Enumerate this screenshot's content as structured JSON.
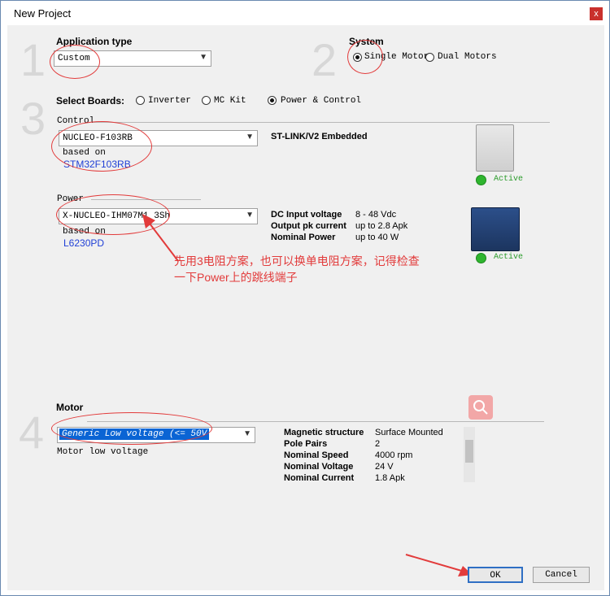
{
  "window": {
    "title": "New Project",
    "close_glyph": "x"
  },
  "steps": {
    "s1": "1",
    "s2": "2",
    "s3": "3",
    "s4": "4"
  },
  "application_type": {
    "label": "Application type",
    "value": "Custom",
    "arrow": "▼"
  },
  "system": {
    "label": "System",
    "options": [
      "Single Motor",
      "Dual Motors"
    ],
    "selected": "Single Motor"
  },
  "select_boards": {
    "label": "Select Boards:",
    "options": [
      "Inverter",
      "MC Kit",
      "Power & Control"
    ],
    "selected": "Power & Control"
  },
  "control": {
    "label": "Control",
    "value": "NUCLEO-F103RB",
    "arrow": "▼",
    "based_on_label": "based on",
    "based_on_value": "STM32F103RB",
    "spec_title": "ST-LINK/V2 Embedded",
    "status": "Active"
  },
  "power": {
    "label": "Power",
    "value": "X-NUCLEO-IHM07M1 3Sh",
    "arrow": "▼",
    "based_on_label": "based on",
    "based_on_value": "L6230PD",
    "specs": [
      {
        "name": "DC Input voltage",
        "value": "8 - 48 Vdc"
      },
      {
        "name": "Output pk current",
        "value": "up to 2.8 Apk"
      },
      {
        "name": "Nominal Power",
        "value": "up to 40 W"
      }
    ],
    "status": "Active"
  },
  "annotation": {
    "line1": "先用3电阻方案，也可以换单电阻方案，记得检查",
    "line2": "一下Power上的跳线端子"
  },
  "motor": {
    "label": "Motor",
    "value": "Generic Low voltage (<= 50V",
    "arrow": "▼",
    "description": "Motor low voltage",
    "specs": [
      {
        "name": "Magnetic structure",
        "value": "Surface Mounted"
      },
      {
        "name": "Pole Pairs",
        "value": "2"
      },
      {
        "name": "Nominal Speed",
        "value": "4000 rpm"
      },
      {
        "name": "Nominal Voltage",
        "value": "24 V"
      },
      {
        "name": "Nominal Current",
        "value": "1.8 Apk"
      }
    ]
  },
  "buttons": {
    "ok": "OK",
    "cancel": "Cancel"
  },
  "colors": {
    "annotation_red": "#e23b3b",
    "active_green": "#2fb52f",
    "link_blue": "#1f3fd6",
    "selection_blue": "#0a64d4"
  }
}
